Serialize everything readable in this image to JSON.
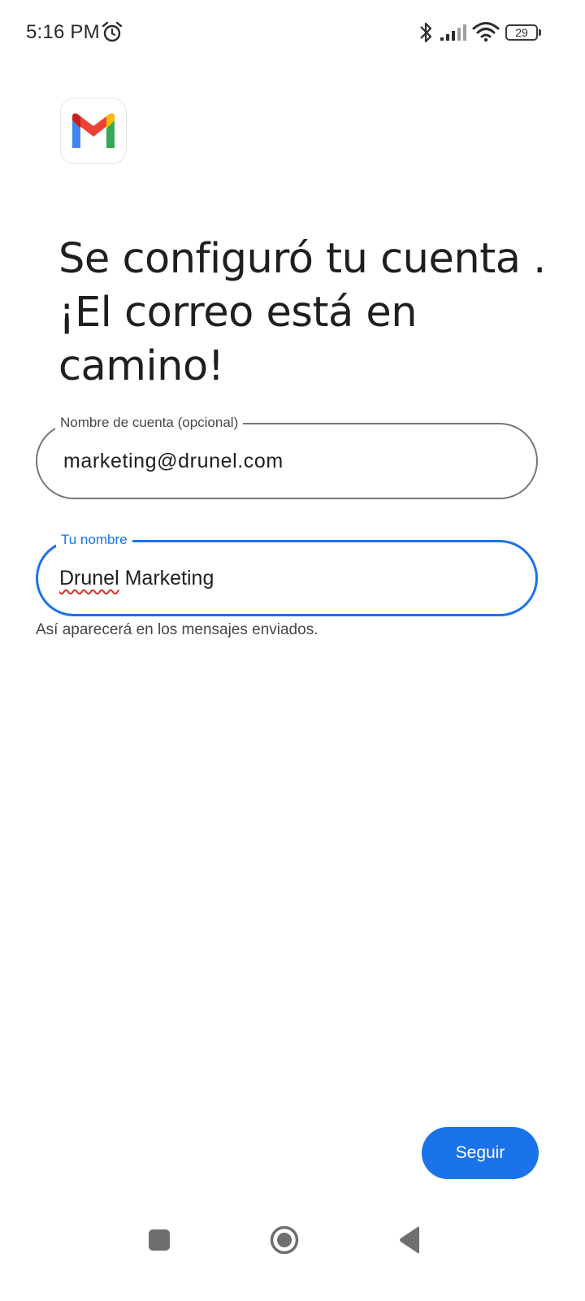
{
  "status_bar": {
    "time": "5:16 PM",
    "battery_level": "29",
    "icons": [
      "alarm-icon",
      "bluetooth-icon",
      "signal-icon",
      "wifi-icon",
      "battery-icon"
    ]
  },
  "logo": {
    "name": "gmail-logo"
  },
  "headline": "Se configuró tu cuenta . ¡El correo está en camino!",
  "account_field": {
    "label": "Nombre de cuenta (opcional)",
    "value": "marketing@drunel.com"
  },
  "name_field": {
    "label": "Tu nombre",
    "value_first": "Drunel",
    "value_rest": " Marketing",
    "helper": "Así aparecerá en los mensajes enviados."
  },
  "next_button": {
    "label": "Seguir"
  },
  "colors": {
    "accent": "#1a73e8",
    "outline": "#747775",
    "spellcheck": "#d93025"
  },
  "nav_bar": [
    "recents-button",
    "home-button",
    "back-button"
  ]
}
